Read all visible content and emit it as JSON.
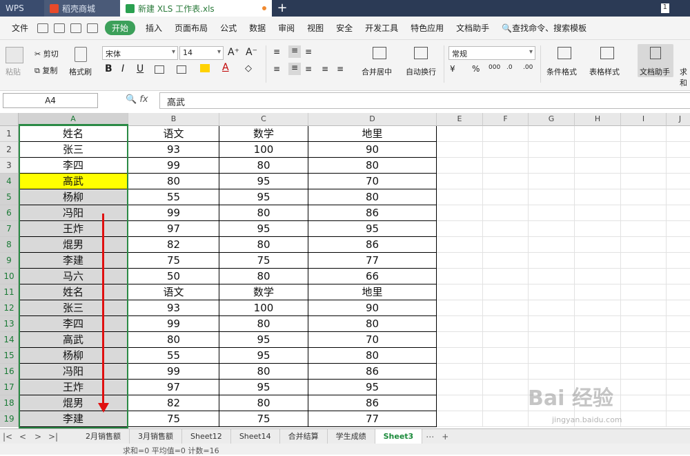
{
  "titlebar": {
    "wps": "WPS",
    "docer": "稻壳商城",
    "file": "新建 XLS 工作表.xls",
    "page_num": "1"
  },
  "menu": {
    "file": "文件",
    "start": "开始",
    "items": [
      "插入",
      "页面布局",
      "公式",
      "数据",
      "审阅",
      "视图",
      "安全",
      "开发工具",
      "特色应用",
      "文档助手"
    ],
    "search": "查找命令、搜索模板"
  },
  "ribbon": {
    "paste": "粘贴",
    "cut": "剪切",
    "copy": "复制",
    "format_painter": "格式刷",
    "font": "宋体",
    "size": "14",
    "merge": "合并居中",
    "wrap": "自动换行",
    "number_format": "常规",
    "cond_format": "条件格式",
    "table_style": "表格样式",
    "doc_assistant": "文档助手",
    "more": "求和"
  },
  "formula": {
    "namebox": "A4",
    "fx": "fx",
    "value": "高武"
  },
  "columns": [
    "A",
    "B",
    "C",
    "D",
    "E",
    "F",
    "G",
    "H",
    "I",
    "J"
  ],
  "rows": [
    [
      "姓名",
      "语文",
      "数学",
      "地里"
    ],
    [
      "张三",
      "93",
      "100",
      "90"
    ],
    [
      "李四",
      "99",
      "80",
      "80"
    ],
    [
      "高武",
      "80",
      "95",
      "70"
    ],
    [
      "杨柳",
      "55",
      "95",
      "80"
    ],
    [
      "冯阳",
      "99",
      "80",
      "86"
    ],
    [
      "王炸",
      "97",
      "95",
      "95"
    ],
    [
      "焜男",
      "82",
      "80",
      "86"
    ],
    [
      "李建",
      "75",
      "75",
      "77"
    ],
    [
      "马六",
      "50",
      "80",
      "66"
    ],
    [
      "姓名",
      "语文",
      "数学",
      "地里"
    ],
    [
      "张三",
      "93",
      "100",
      "90"
    ],
    [
      "李四",
      "99",
      "80",
      "80"
    ],
    [
      "高武",
      "80",
      "95",
      "70"
    ],
    [
      "杨柳",
      "55",
      "95",
      "80"
    ],
    [
      "冯阳",
      "99",
      "80",
      "86"
    ],
    [
      "王炸",
      "97",
      "95",
      "95"
    ],
    [
      "焜男",
      "82",
      "80",
      "86"
    ],
    [
      "李建",
      "75",
      "75",
      "77"
    ]
  ],
  "row_numbers": [
    "1",
    "2",
    "3",
    "4",
    "5",
    "6",
    "7",
    "8",
    "9",
    "10",
    "11",
    "12",
    "13",
    "14",
    "15",
    "16",
    "17",
    "18",
    "19"
  ],
  "sheets": [
    "2月销售额",
    "3月销售额",
    "Sheet12",
    "Sheet14",
    "合并结算",
    "学生成绩",
    "Sheet3"
  ],
  "active_sheet": "Sheet3",
  "status": "求和=0  平均值=0  计数=16",
  "watermark": "Bai 经验",
  "watermark_url": "jingyan.baidu.com",
  "colors": {
    "highlight": "#ffff00",
    "selection": "#2a8a45",
    "arrow": "#e01010"
  }
}
